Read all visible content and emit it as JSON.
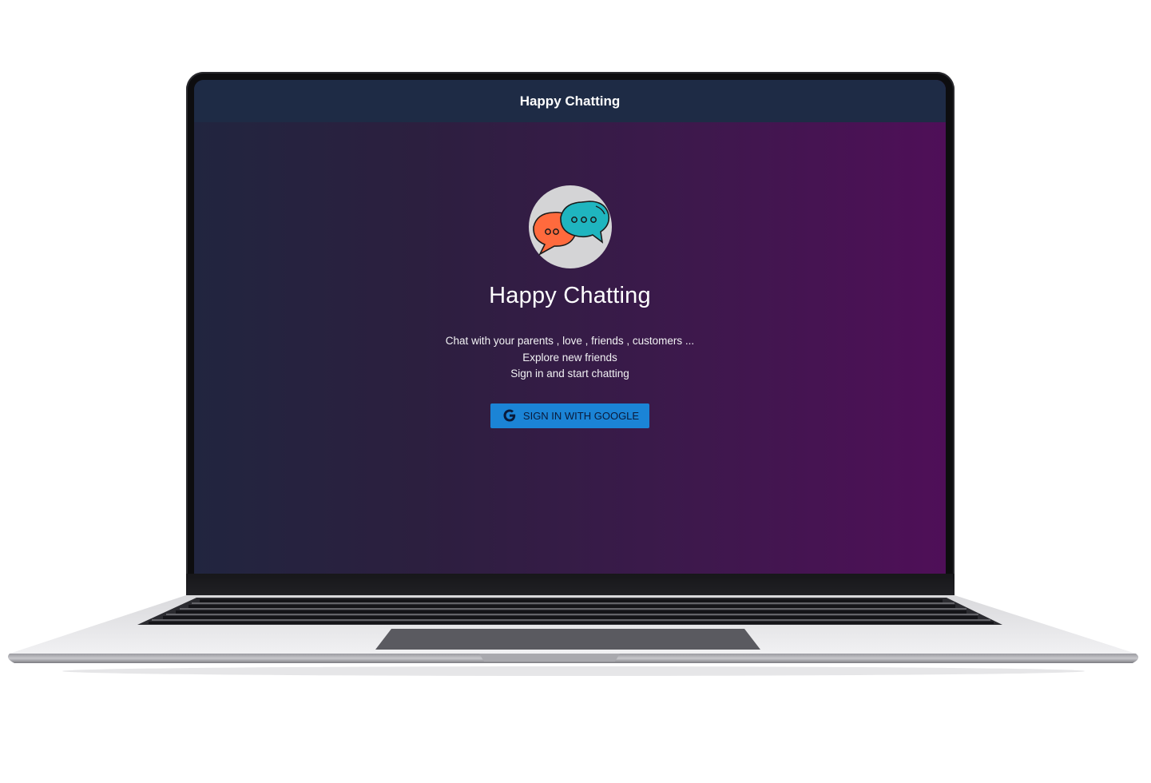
{
  "app": {
    "header_title": "Happy Chatting",
    "hero_title": "Happy Chatting",
    "tagline": [
      "Chat with your parents , love , friends , customers ...",
      "Explore new friends",
      "Sign in and start chatting"
    ],
    "signin_button_label": "SIGN IN WITH GOOGLE",
    "logo_icon": "chat-bubbles-icon",
    "google_icon": "google-g-icon"
  },
  "colors": {
    "header_bg": "#1e2b45",
    "gradient_start": "#21253f",
    "gradient_end": "#4f0f58",
    "button_bg": "#1b84d6",
    "bubble_orange": "#ff6a3d",
    "bubble_teal": "#1fb5bf"
  }
}
